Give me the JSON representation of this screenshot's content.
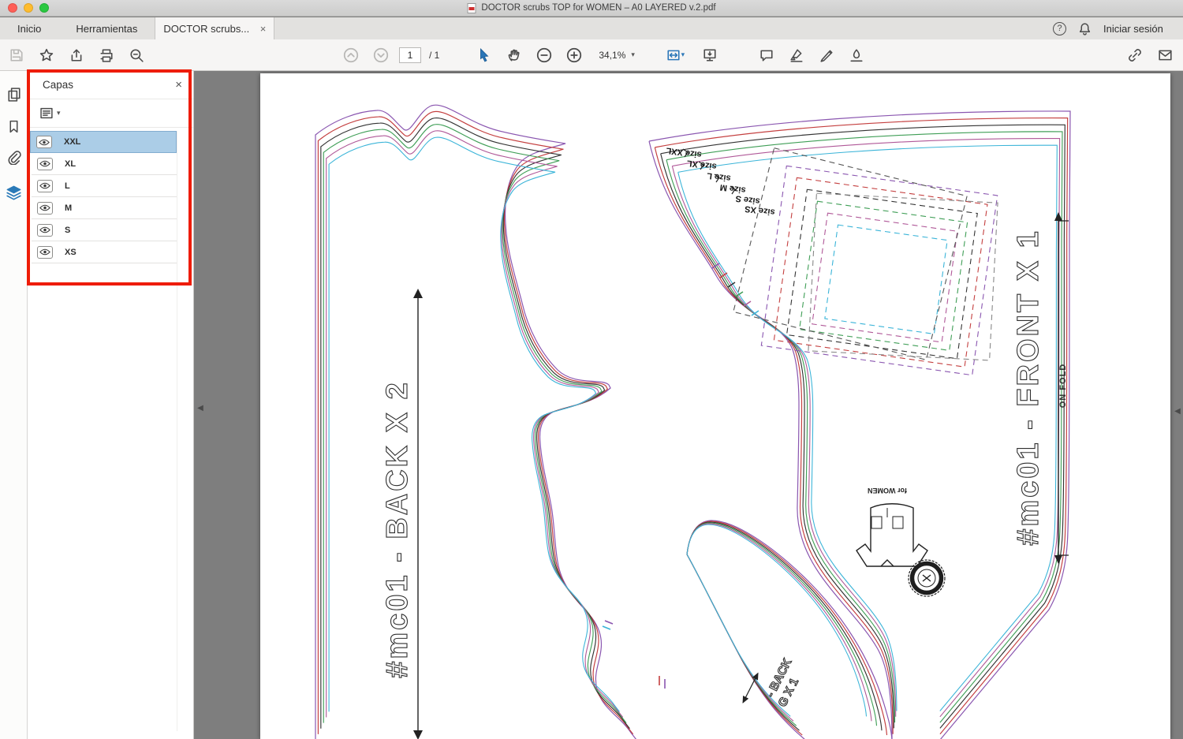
{
  "window": {
    "title": "DOCTOR scrubs TOP for WOMEN – A0 LAYERED v.2.pdf"
  },
  "tabbar": {
    "home": "Inicio",
    "tools": "Herramientas",
    "document_tab": "DOCTOR scrubs...",
    "close_glyph": "×",
    "help_glyph": "?",
    "sign_in": "Iniciar sesión"
  },
  "toolbar": {
    "page_current": "1",
    "page_total": "/ 1",
    "zoom_value": "34,1%"
  },
  "glyphs": {
    "caret_down": "▾",
    "collapse_left": "◀"
  },
  "layers_panel": {
    "title": "Capas",
    "close_glyph": "×",
    "selection_color": "#abcde7",
    "items": [
      {
        "label": "XXL",
        "selected": true
      },
      {
        "label": "XL",
        "selected": false
      },
      {
        "label": "L",
        "selected": false
      },
      {
        "label": "M",
        "selected": false
      },
      {
        "label": "S",
        "selected": false
      },
      {
        "label": "XS",
        "selected": false
      }
    ]
  },
  "annotation": {
    "color": "#ee1c07"
  },
  "pattern": {
    "back_label": "#mc01 - BACK X 2",
    "front_label": "#mc01 - FRONT X 1",
    "on_fold": "ON FOLD",
    "size_labels": [
      "size XXL",
      "size XL",
      "size L",
      "size M",
      "size S",
      "size XS"
    ],
    "sleeve_label_line1": "- BACK",
    "sleeve_label_line2": "G X 1",
    "logo_text": "for WOMEN",
    "size_colors": {
      "XXL": "#8a56b0",
      "XL": "#c43f3f",
      "L": "#333333",
      "M": "#3f9e56",
      "S": "#b05898",
      "XS": "#3ab4d8"
    }
  }
}
